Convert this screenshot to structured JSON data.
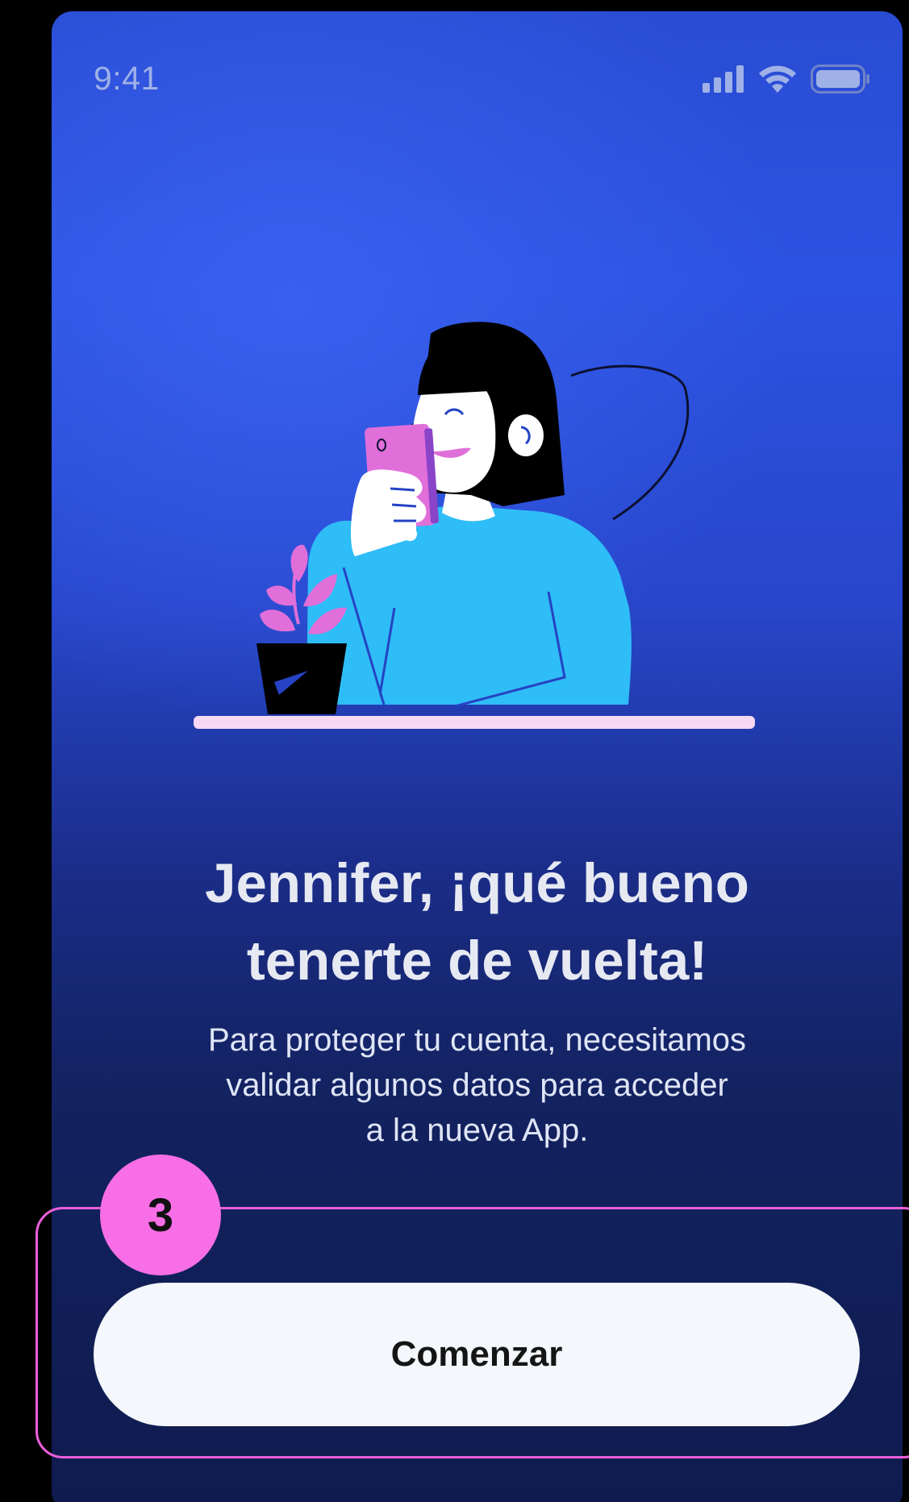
{
  "status_bar": {
    "time": "9:41",
    "icons": [
      "cellular-signal-icon",
      "wifi-icon",
      "battery-icon"
    ]
  },
  "illustration": {
    "subject": "woman-holding-phone-illustration",
    "elements": [
      "woman-figure",
      "phone-in-hand",
      "potted-plant",
      "desk-surface"
    ]
  },
  "welcome": {
    "title_line1": "Jennifer, ¡qué bueno",
    "title_line2": "tenerte de vuelta!",
    "subtitle_line1": "Para proteger tu cuenta, necesitamos",
    "subtitle_line2": "validar algunos datos para acceder",
    "subtitle_line3": "a la nueva App."
  },
  "annotation": {
    "step_number": "3"
  },
  "actions": {
    "start_label": "Comenzar"
  },
  "colors": {
    "background_top": "#2c52e2",
    "background_bottom": "#0f1b4e",
    "highlight_border": "#ea5fdc",
    "badge": "#f76ee6",
    "button_bg": "#f4f7fb",
    "sweater": "#2fbdf7",
    "accent_pink": "#e06fd9",
    "desk": "#f8d9f3"
  }
}
